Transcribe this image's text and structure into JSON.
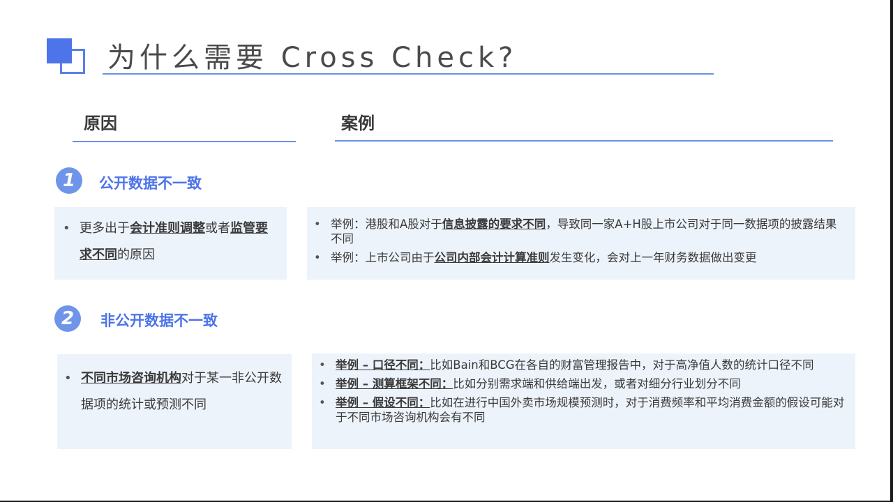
{
  "title": "为什么需要 Cross Check?",
  "columns": {
    "reason": "原因",
    "case": "案例"
  },
  "sections": [
    {
      "number": "1",
      "label": "公开数据不一致",
      "reason": {
        "p1": "更多出于",
        "b1": "会计准则调整",
        "p2": "或者",
        "b2": "监管要求不同",
        "p3": "的原因"
      },
      "cases": [
        {
          "p1": "举例：港股和A股对于",
          "b1": "信息披露的要求不同",
          "p2": "，导致同一家A+H股上市公司对于同一数据项的披露结果不同"
        },
        {
          "p1": "举例：上市公司由于",
          "b1": "公司内部会计计算准则",
          "p2": "发生变化，会对上一年财务数据做出变更"
        }
      ]
    },
    {
      "number": "2",
      "label": "非公开数据不一致",
      "reason": {
        "b1": "不同市场咨询机构",
        "p1": "对于某一非公开数据项的统计或预测不同"
      },
      "cases": [
        {
          "b1": "举例 – 口径不同：",
          "p1": "比如Bain和BCG在各自的财富管理报告中，对于高净值人数的统计口径不同"
        },
        {
          "b1": "举例 – 测算框架不同：",
          "p1": "比如分别需求端和供给端出发，或者对细分行业划分不同"
        },
        {
          "b1": "举例 – 假设不同：",
          "p1": "比如在进行中国外卖市场规模预测时，对于消费频率和平均消费金额的假设可能对于不同市场咨询机构会有不同"
        }
      ]
    }
  ],
  "colors": {
    "accent": "#4d74e8",
    "box": "#edf3fb"
  }
}
